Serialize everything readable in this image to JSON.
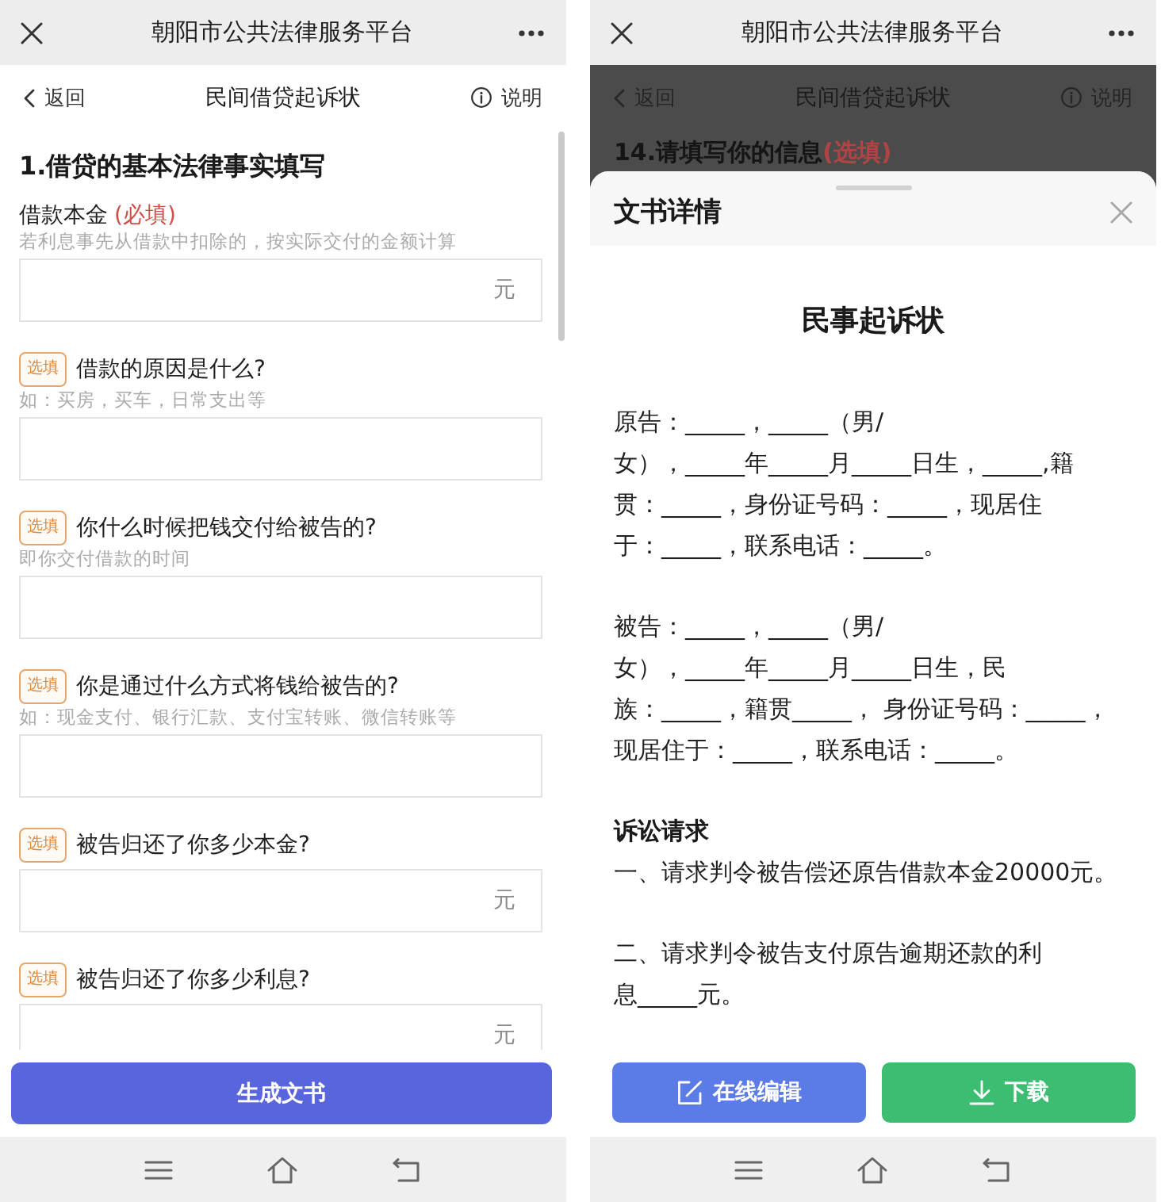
{
  "form_screen": {
    "app_bar": {
      "title": "朝阳市公共法律服务平台"
    },
    "nav_bar": {
      "back": "返回",
      "title": "民间借贷起诉状",
      "help": "说明"
    },
    "section_title": "1.借贷的基本法律事实填写",
    "fields": [
      {
        "kind": "required",
        "label": "借款本金",
        "tag": "(必填)",
        "hint": "若利息事先从借款中扣除的，按实际交付的金额计算",
        "unit": "元"
      },
      {
        "kind": "optional",
        "tag": "选填",
        "label": "借款的原因是什么?",
        "hint": "如：买房，买车，日常支出等"
      },
      {
        "kind": "optional",
        "tag": "选填",
        "label": "你什么时候把钱交付给被告的?",
        "hint": "即你交付借款的时间"
      },
      {
        "kind": "optional",
        "tag": "选填",
        "label": "你是通过什么方式将钱给被告的?",
        "hint": "如：现金支付、银行汇款、支付宝转账、微信转账等"
      },
      {
        "kind": "optional",
        "tag": "选填",
        "label": "被告归还了你多少本金?",
        "unit": "元"
      },
      {
        "kind": "optional",
        "tag": "选填",
        "label": "被告归还了你多少利息?",
        "unit": "元"
      }
    ],
    "submit_button": "生成文书"
  },
  "document_screen": {
    "app_bar": {
      "title": "朝阳市公共法律服务平台"
    },
    "nav_bar": {
      "back": "返回",
      "title": "民间借贷起诉状",
      "help": "说明"
    },
    "section_title": {
      "text": "14.请填写你的信息",
      "tag": "(选填)"
    },
    "sheet": {
      "title": "文书详情",
      "document_title": "民事起诉状",
      "blocks": [
        {
          "kind": "paragraph",
          "text": "原告：_____，_____（男/女），_____年_____月_____日生，_____,籍贯：_____，身份证号码：_____，现居住于：_____，联系电话：_____。"
        },
        {
          "kind": "paragraph",
          "text": "被告：_____，_____（男/女），_____年_____月_____日生，民族：_____，籍贯_____， 身份证号码：_____，现居住于：_____，联系电话：_____。"
        },
        {
          "kind": "heading",
          "text": "诉讼请求"
        },
        {
          "kind": "paragraph",
          "text": "一、请求判令被告偿还原告借款本金20000元。"
        },
        {
          "kind": "paragraph",
          "text": "二、请求判令被告支付原告逾期还款的利息_____元。"
        }
      ]
    },
    "buttons": [
      {
        "kind": "edit",
        "label": "在线编辑"
      },
      {
        "kind": "download",
        "label": "下载"
      }
    ]
  }
}
